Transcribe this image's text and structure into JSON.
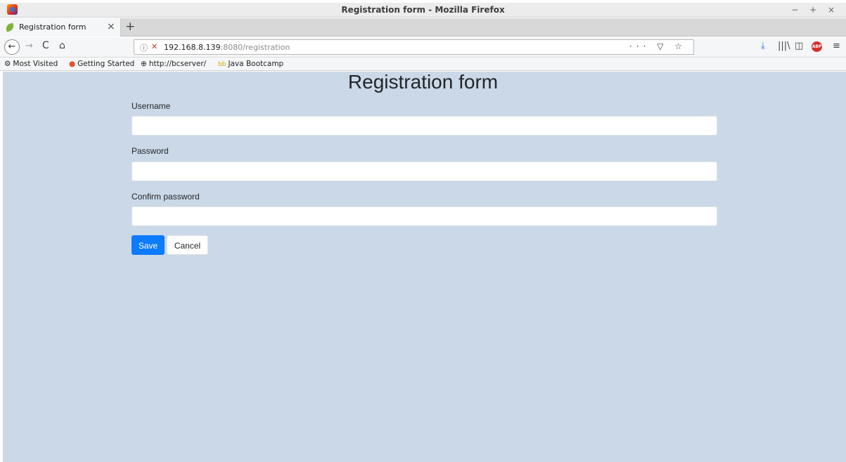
{
  "browser": {
    "window_title": "Registration form - Mozilla Firefox",
    "window_controls": "− + ×",
    "tab": {
      "title": "Registration form",
      "close": "×"
    },
    "new_tab": "+",
    "nav": {
      "back": "←",
      "forward": "→",
      "reload": "C",
      "home": "⌂"
    },
    "url": {
      "host": "192.168.8.139",
      "rest": ":8080/registration",
      "actions": "··· ▽ ☆"
    },
    "toolbar": {
      "download": "⤓",
      "library": "|||\\",
      "sidebar": "◫",
      "abp": "ABP",
      "menu": "≡"
    },
    "bookmarks": [
      {
        "icon": "⚙",
        "label": "Most Visited"
      },
      {
        "icon": "●",
        "label": "Getting Started"
      },
      {
        "icon": "⊕",
        "label": "http://bcserver/"
      },
      {
        "icon": "bb",
        "label": "Java Bootcamp"
      }
    ]
  },
  "page": {
    "title": "Registration form",
    "fields": [
      {
        "label": "Username",
        "value": ""
      },
      {
        "label": "Password",
        "value": ""
      },
      {
        "label": "Confirm password",
        "value": ""
      }
    ],
    "buttons": {
      "save": "Save",
      "cancel": "Cancel"
    }
  },
  "colors": {
    "page_background": "#cbd8e7",
    "primary_button": "#0d7bfe"
  }
}
